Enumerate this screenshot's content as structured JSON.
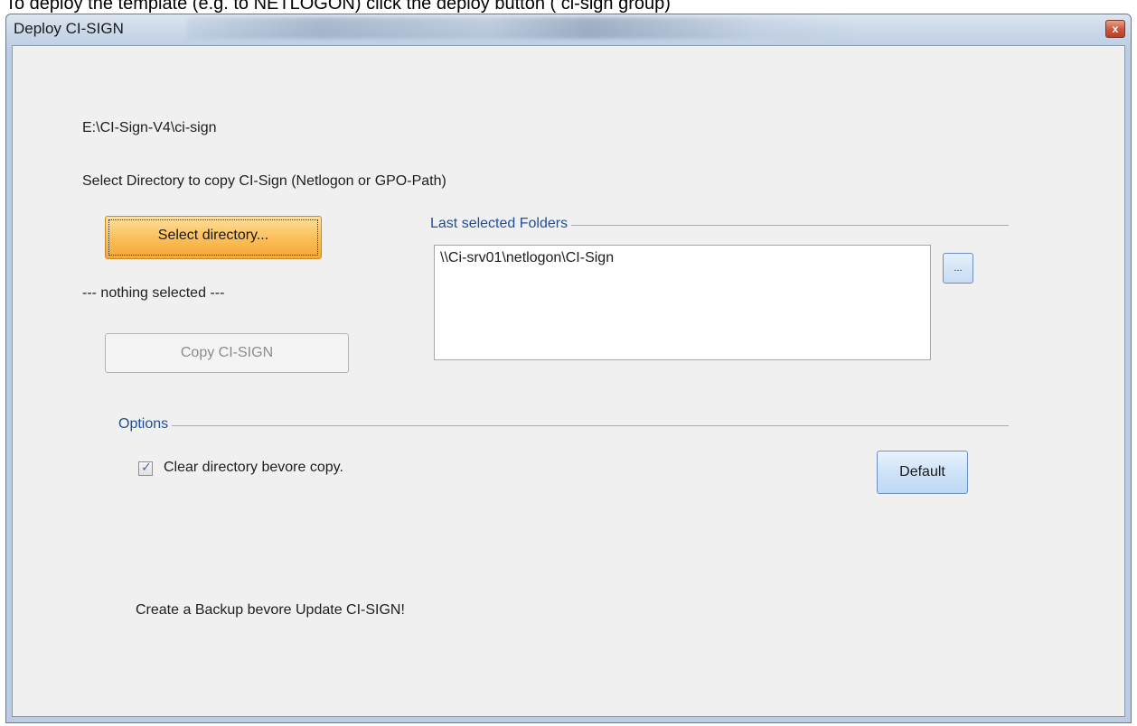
{
  "page": {
    "caption": "To deploy the template (e.g. to NETLOGON) click the deploy button ( ci-sign group)"
  },
  "window": {
    "title": "Deploy CI-SIGN",
    "close_glyph": "x"
  },
  "main": {
    "current_path": "E:\\CI-Sign-V4\\ci-sign",
    "select_instruction": "Select Directory to copy CI-Sign (Netlogon or GPO-Path)",
    "select_button_label": "Select directory...",
    "selection_status": "--- nothing selected ---",
    "copy_button_label": "Copy CI-SIGN",
    "copy_button_enabled": false,
    "select_button_color": "#f5a833"
  },
  "folders": {
    "header": "Last selected Folders",
    "items": [
      "\\\\Ci-srv01\\netlogon\\CI-Sign"
    ],
    "browse_button_label": "..."
  },
  "options": {
    "header": "Options",
    "clear_checkbox_label": "Clear directory bevore copy.",
    "clear_checkbox_checked": true,
    "check_glyph": "✓",
    "default_button_label": "Default"
  },
  "footer": {
    "backup_note": "Create a Backup bevore Update CI-SIGN!"
  }
}
